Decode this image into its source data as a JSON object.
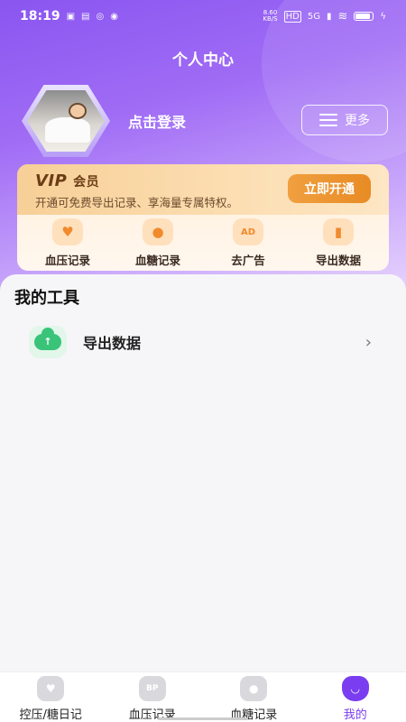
{
  "status_bar": {
    "time": "18:19",
    "left_icons": [
      "app-notification-icon",
      "picture-icon",
      "link-icon",
      "game-icon"
    ],
    "net_speed_value": "8.60",
    "net_speed_unit": "KB/S",
    "hd_badge": "HD",
    "signal_label": "5G"
  },
  "header": {
    "title": "个人中心"
  },
  "profile": {
    "login_text": "点击登录",
    "more_label": "更多"
  },
  "vip": {
    "title_prefix": "VIP",
    "title_suffix": "会员",
    "description": "开通可免费导出记录、享海量专属特权。",
    "open_button": "立即开通",
    "perks": [
      {
        "label": "血压记录",
        "icon": "heart-icon"
      },
      {
        "label": "血糖记录",
        "icon": "blood-drop-icon"
      },
      {
        "label": "去广告",
        "icon": "ad-icon",
        "icon_text": "AD"
      },
      {
        "label": "导出数据",
        "icon": "bar-chart-icon"
      }
    ]
  },
  "tools": {
    "section_title": "我的工具",
    "items": [
      {
        "label": "导出数据",
        "icon": "cloud-upload-icon"
      }
    ]
  },
  "tabbar": {
    "tabs": [
      {
        "label": "控压/糖日记",
        "active": false
      },
      {
        "label": "血压记录",
        "active": false,
        "icon_text": "BP"
      },
      {
        "label": "血糖记录",
        "active": false
      },
      {
        "label": "我的",
        "active": true
      }
    ]
  },
  "colors": {
    "primary": "#7a3df0",
    "vip_button": "#e88b24",
    "tool_green": "#39c479"
  }
}
